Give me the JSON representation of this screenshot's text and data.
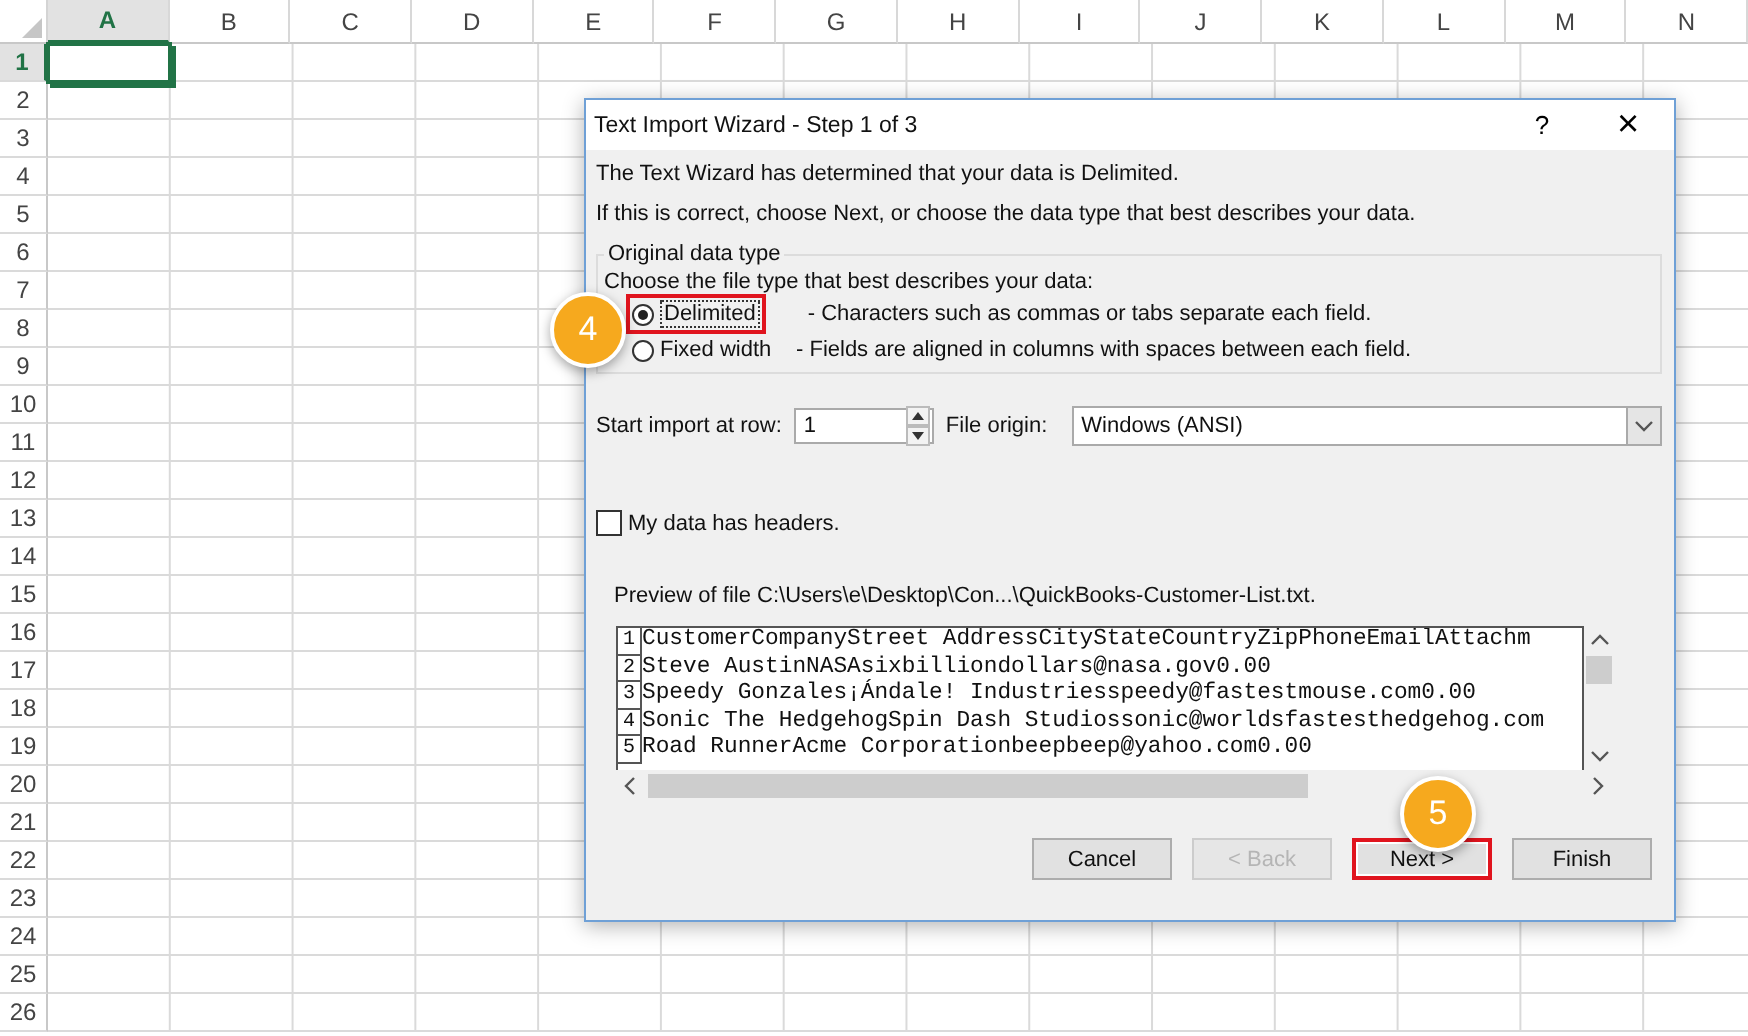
{
  "sheet": {
    "columns": [
      {
        "label": "A",
        "selected": true
      },
      {
        "label": "B",
        "selected": false
      },
      {
        "label": "C",
        "selected": false
      },
      {
        "label": "D",
        "selected": false
      },
      {
        "label": "E",
        "selected": false
      },
      {
        "label": "F",
        "selected": false
      },
      {
        "label": "G",
        "selected": false
      },
      {
        "label": "H",
        "selected": false
      },
      {
        "label": "I",
        "selected": false
      },
      {
        "label": "J",
        "selected": false
      },
      {
        "label": "K",
        "selected": false
      },
      {
        "label": "L",
        "selected": false
      },
      {
        "label": "M",
        "selected": false
      },
      {
        "label": "N",
        "selected": false
      }
    ],
    "rows": [
      {
        "label": "1",
        "selected": true
      },
      {
        "label": "2",
        "selected": false
      },
      {
        "label": "3",
        "selected": false
      },
      {
        "label": "4",
        "selected": false
      },
      {
        "label": "5",
        "selected": false
      },
      {
        "label": "6",
        "selected": false
      },
      {
        "label": "7",
        "selected": false
      },
      {
        "label": "8",
        "selected": false
      },
      {
        "label": "9",
        "selected": false
      },
      {
        "label": "10",
        "selected": false
      },
      {
        "label": "11",
        "selected": false
      },
      {
        "label": "12",
        "selected": false
      },
      {
        "label": "13",
        "selected": false
      },
      {
        "label": "14",
        "selected": false
      },
      {
        "label": "15",
        "selected": false
      },
      {
        "label": "16",
        "selected": false
      },
      {
        "label": "17",
        "selected": false
      },
      {
        "label": "18",
        "selected": false
      },
      {
        "label": "19",
        "selected": false
      },
      {
        "label": "20",
        "selected": false
      },
      {
        "label": "21",
        "selected": false
      },
      {
        "label": "22",
        "selected": false
      },
      {
        "label": "23",
        "selected": false
      },
      {
        "label": "24",
        "selected": false
      },
      {
        "label": "25",
        "selected": false
      },
      {
        "label": "26",
        "selected": false
      }
    ]
  },
  "dialog": {
    "title": "Text Import Wizard - Step 1 of 3",
    "help": "?",
    "close": "×",
    "messages": [
      "The Text Wizard has determined that your data is Delimited.",
      "If this is correct, choose Next, or choose the data type that best describes your data."
    ],
    "group": {
      "title": "Original data type",
      "prompt": "Choose the file type that best describes your data:",
      "options": [
        {
          "label": "Delimited",
          "description": "- Characters such as commas or tabs separate each field.",
          "selected": true,
          "highlighted": true
        },
        {
          "label": "Fixed width",
          "description": "- Fields are aligned in columns with spaces between each field.",
          "selected": false,
          "highlighted": false
        }
      ]
    },
    "start_row": {
      "label": "Start import at row:",
      "value": "1"
    },
    "file_origin": {
      "label": "File origin:",
      "value": "Windows (ANSI)"
    },
    "headers_checkbox": {
      "label": "My data has headers.",
      "checked": false
    },
    "preview": {
      "label": "Preview of file C:\\Users\\e\\Desktop\\Con...\\QuickBooks-Customer-List.txt.",
      "lines": [
        {
          "number": "1",
          "text": "CustomerCompanyStreet AddressCityStateCountryZipPhoneEmailAttachm"
        },
        {
          "number": "2",
          "text": "Steve AustinNASAsixbilliondollars@nasa.gov0.00"
        },
        {
          "number": "3",
          "text": "Speedy Gonzales¡Ándale! Industriesspeedy@fastestmouse.com0.00"
        },
        {
          "number": "4",
          "text": "Sonic The HedgehogSpin Dash Studiossonic@worldsfastesthedgehog.com"
        },
        {
          "number": "5",
          "text": "Road RunnerAcme Corporationbeepbeep@yahoo.com0.00"
        }
      ]
    },
    "buttons": [
      {
        "label": "Cancel",
        "disabled": false,
        "highlighted": false
      },
      {
        "label": "< Back",
        "disabled": true,
        "highlighted": false
      },
      {
        "label": "Next >",
        "disabled": false,
        "highlighted": true
      },
      {
        "label": "Finish",
        "disabled": false,
        "highlighted": false
      }
    ]
  },
  "callouts": [
    {
      "label": "4"
    },
    {
      "label": "5"
    }
  ]
}
